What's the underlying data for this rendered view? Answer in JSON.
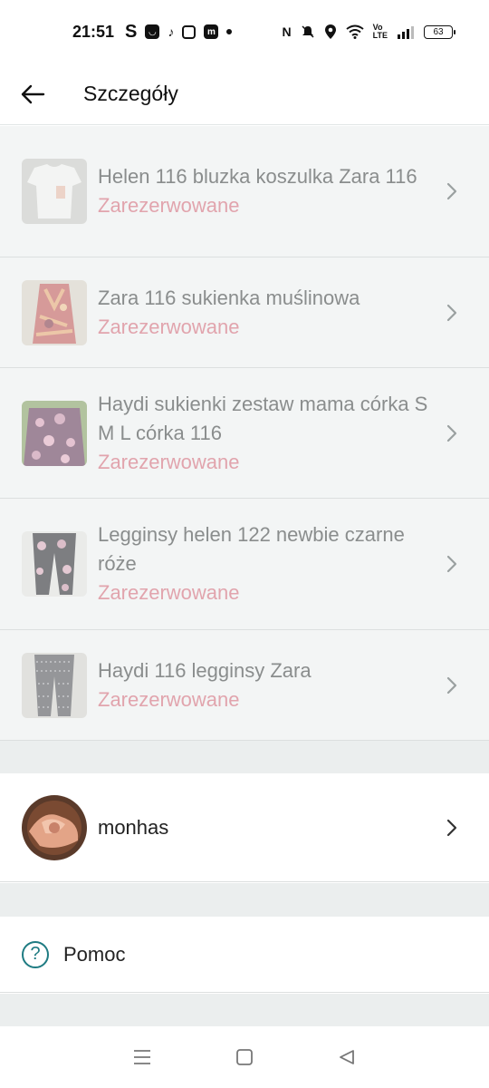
{
  "status_bar": {
    "time": "21:51",
    "icons": [
      "s-icon",
      "notification-app-icon",
      "tiktok-icon",
      "instagram-icon",
      "m-app-icon",
      "dot-icon",
      "nfc-icon",
      "mute-icon",
      "location-icon",
      "wifi-icon",
      "volte-icon",
      "signal-icon"
    ],
    "battery": "63"
  },
  "app_bar": {
    "title": "Szczegóły"
  },
  "items": [
    {
      "title": "Helen 116 bluzka koszulka Zara 116",
      "status": "Zarezerwowane",
      "thumb": "white-shirt"
    },
    {
      "title": "Zara 116 sukienka muślinowa",
      "status": "Zarezerwowane",
      "thumb": "floral-dress"
    },
    {
      "title": "Haydi sukienki zestaw mama córka S M L córka 116",
      "status": "Zarezerwowane",
      "thumb": "purple-dress"
    },
    {
      "title": "Legginsy helen 122 newbie czarne róże",
      "status": "Zarezerwowane",
      "thumb": "black-leggings"
    },
    {
      "title": "Haydi 116 legginsy Zara",
      "status": "Zarezerwowane",
      "thumb": "grey-leggings"
    }
  ],
  "user": {
    "name": "monhas"
  },
  "help": {
    "label": "Pomoc"
  },
  "colors": {
    "accent": "#1e7b82",
    "reserved": "#e1a4ad",
    "muted_text": "#8a8d8d",
    "list_bg": "#f3f5f5"
  }
}
